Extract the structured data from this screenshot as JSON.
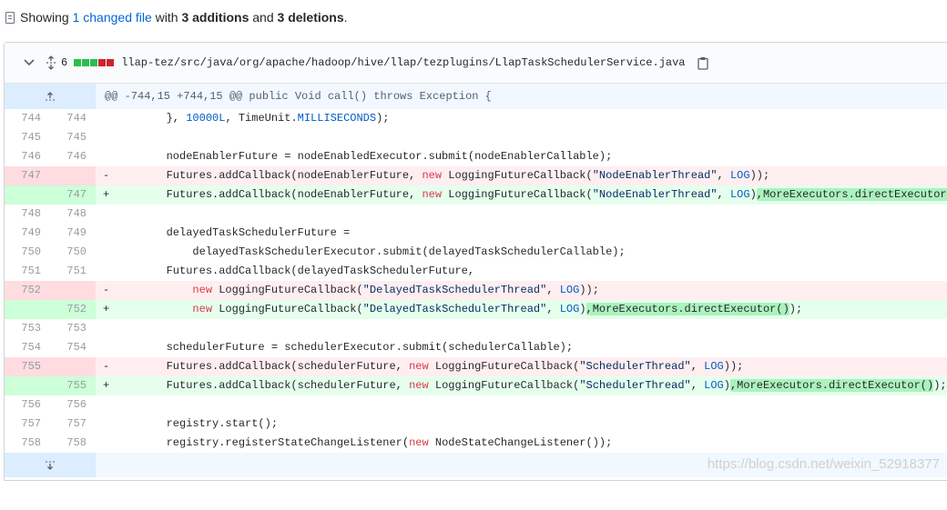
{
  "summary": {
    "prefix": "Showing ",
    "changed": "1 changed file",
    "mid1": " with ",
    "additions": "3 additions",
    "mid2": " and ",
    "deletions": "3 deletions",
    "suffix": "."
  },
  "file": {
    "change_count": "6",
    "diffstat_colors": [
      "#2cbe4e",
      "#2cbe4e",
      "#2cbe4e",
      "#cb2431",
      "#cb2431"
    ],
    "path": "llap-tez/src/java/org/apache/hadoop/hive/llap/tezplugins/LlapTaskSchedulerService.java",
    "hunk_header": "@@ -744,15 +744,15 @@ public Void call() throws Exception {"
  },
  "lines": [
    {
      "type": "ctx",
      "old": "744",
      "new": "744",
      "sign": "",
      "segs": [
        [
          "",
          "        }, "
        ],
        [
          "cst",
          "10000L"
        ],
        [
          "",
          ", TimeUnit."
        ],
        [
          "cst",
          "MILLISECONDS"
        ],
        [
          "",
          ");"
        ]
      ]
    },
    {
      "type": "ctx",
      "old": "745",
      "new": "745",
      "sign": "",
      "segs": []
    },
    {
      "type": "ctx",
      "old": "746",
      "new": "746",
      "sign": "",
      "segs": [
        [
          "",
          "        nodeEnablerFuture = nodeEnabledExecutor.submit(nodeEnablerCallable);"
        ]
      ]
    },
    {
      "type": "del",
      "old": "747",
      "new": "",
      "sign": "-",
      "segs": [
        [
          "",
          "        Futures.addCallback(nodeEnablerFuture, "
        ],
        [
          "kw",
          "new"
        ],
        [
          "",
          " LoggingFutureCallback("
        ],
        [
          "str",
          "\"NodeEnablerThread\""
        ],
        [
          "",
          ", "
        ],
        [
          "cst",
          "LOG"
        ],
        [
          "",
          "));"
        ]
      ]
    },
    {
      "type": "add",
      "old": "",
      "new": "747",
      "sign": "+",
      "segs": [
        [
          "",
          "        Futures.addCallback(nodeEnablerFuture, "
        ],
        [
          "kw",
          "new"
        ],
        [
          "",
          " LoggingFutureCallback("
        ],
        [
          "str",
          "\"NodeEnablerThread\""
        ],
        [
          "",
          ", "
        ],
        [
          "cst",
          "LOG"
        ],
        [
          "",
          ")"
        ],
        [
          "hl",
          ",MoreExecutors.directExecutor()"
        ],
        [
          "",
          ");"
        ]
      ]
    },
    {
      "type": "ctx",
      "old": "748",
      "new": "748",
      "sign": "",
      "segs": []
    },
    {
      "type": "ctx",
      "old": "749",
      "new": "749",
      "sign": "",
      "segs": [
        [
          "",
          "        delayedTaskSchedulerFuture ="
        ]
      ]
    },
    {
      "type": "ctx",
      "old": "750",
      "new": "750",
      "sign": "",
      "segs": [
        [
          "",
          "            delayedTaskSchedulerExecutor.submit(delayedTaskSchedulerCallable);"
        ]
      ]
    },
    {
      "type": "ctx",
      "old": "751",
      "new": "751",
      "sign": "",
      "segs": [
        [
          "",
          "        Futures.addCallback(delayedTaskSchedulerFuture,"
        ]
      ]
    },
    {
      "type": "del",
      "old": "752",
      "new": "",
      "sign": "-",
      "segs": [
        [
          "",
          "            "
        ],
        [
          "kw",
          "new"
        ],
        [
          "",
          " LoggingFutureCallback("
        ],
        [
          "str",
          "\"DelayedTaskSchedulerThread\""
        ],
        [
          "",
          ", "
        ],
        [
          "cst",
          "LOG"
        ],
        [
          "",
          "));"
        ]
      ]
    },
    {
      "type": "add",
      "old": "",
      "new": "752",
      "sign": "+",
      "segs": [
        [
          "",
          "            "
        ],
        [
          "kw",
          "new"
        ],
        [
          "",
          " LoggingFutureCallback("
        ],
        [
          "str",
          "\"DelayedTaskSchedulerThread\""
        ],
        [
          "",
          ", "
        ],
        [
          "cst",
          "LOG"
        ],
        [
          "",
          ")"
        ],
        [
          "hl",
          ",MoreExecutors.directExecutor()"
        ],
        [
          "",
          ");"
        ]
      ]
    },
    {
      "type": "ctx",
      "old": "753",
      "new": "753",
      "sign": "",
      "segs": []
    },
    {
      "type": "ctx",
      "old": "754",
      "new": "754",
      "sign": "",
      "segs": [
        [
          "",
          "        schedulerFuture = schedulerExecutor.submit(schedulerCallable);"
        ]
      ]
    },
    {
      "type": "del",
      "old": "755",
      "new": "",
      "sign": "-",
      "segs": [
        [
          "",
          "        Futures.addCallback(schedulerFuture, "
        ],
        [
          "kw",
          "new"
        ],
        [
          "",
          " LoggingFutureCallback("
        ],
        [
          "str",
          "\"SchedulerThread\""
        ],
        [
          "",
          ", "
        ],
        [
          "cst",
          "LOG"
        ],
        [
          "",
          "));"
        ]
      ]
    },
    {
      "type": "add",
      "old": "",
      "new": "755",
      "sign": "+",
      "segs": [
        [
          "",
          "        Futures.addCallback(schedulerFuture, "
        ],
        [
          "kw",
          "new"
        ],
        [
          "",
          " LoggingFutureCallback("
        ],
        [
          "str",
          "\"SchedulerThread\""
        ],
        [
          "",
          ", "
        ],
        [
          "cst",
          "LOG"
        ],
        [
          "",
          ")"
        ],
        [
          "hl",
          ",MoreExecutors.directExecutor()"
        ],
        [
          "",
          ");"
        ]
      ]
    },
    {
      "type": "ctx",
      "old": "756",
      "new": "756",
      "sign": "",
      "segs": []
    },
    {
      "type": "ctx",
      "old": "757",
      "new": "757",
      "sign": "",
      "segs": [
        [
          "",
          "        registry.start();"
        ]
      ]
    },
    {
      "type": "ctx",
      "old": "758",
      "new": "758",
      "sign": "",
      "segs": [
        [
          "",
          "        registry.registerStateChangeListener("
        ],
        [
          "kw",
          "new"
        ],
        [
          "",
          " NodeStateChangeListener());"
        ]
      ]
    }
  ],
  "watermark": "https://blog.csdn.net/weixin_52918377"
}
